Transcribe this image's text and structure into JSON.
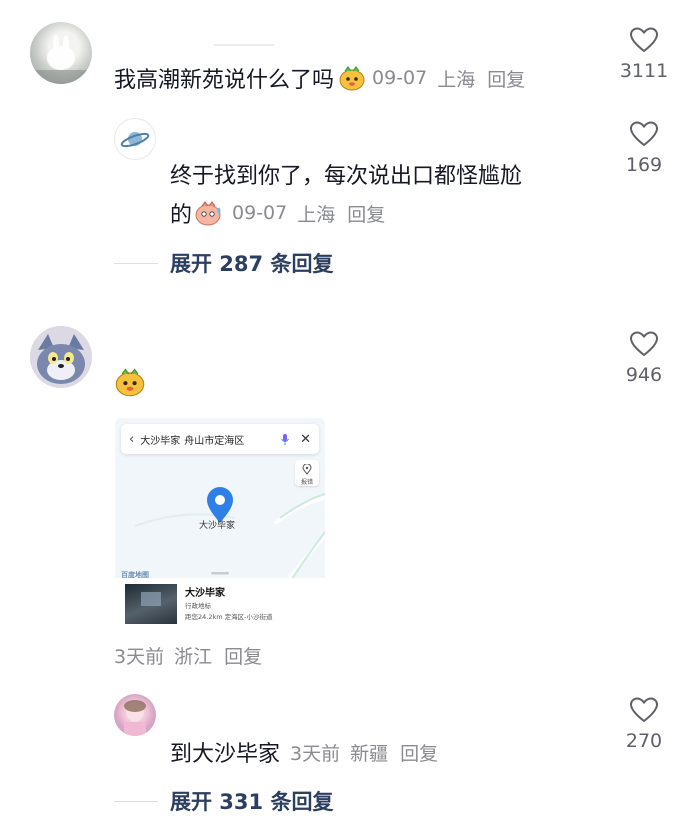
{
  "comments": [
    {
      "text": "我高潮新苑说什么了吗",
      "date": "09-07",
      "location": "上海",
      "reply_label": "回复",
      "likes": "3111",
      "replies": [
        {
          "text_line1": "终于找到你了，每次说出口都怪尴尬",
          "text_line2": "的",
          "date": "09-07",
          "location": "上海",
          "reply_label": "回复",
          "likes": "169"
        }
      ],
      "expand_label": "展开 287 条回复"
    },
    {
      "date": "3天前",
      "location": "浙江",
      "reply_label": "回复",
      "likes": "946",
      "map": {
        "search_title": "大沙毕家",
        "search_region": "舟山市定海区",
        "pin_label": "大沙毕家",
        "side_button": "报错",
        "map_logo": "百度地图",
        "place_name": "大沙毕家",
        "place_type": "行政地标",
        "place_detail": "距您24.2km  定海区-小沙街道"
      },
      "replies": [
        {
          "text": "到大沙毕家",
          "date": "3天前",
          "location": "新疆",
          "reply_label": "回复",
          "likes": "270"
        }
      ],
      "expand_label": "展开 331 条回复"
    }
  ],
  "colors": {
    "text": "#161823",
    "meta": "#8a8b91",
    "link": "#2c3f60",
    "pin": "#2f7fe8"
  }
}
